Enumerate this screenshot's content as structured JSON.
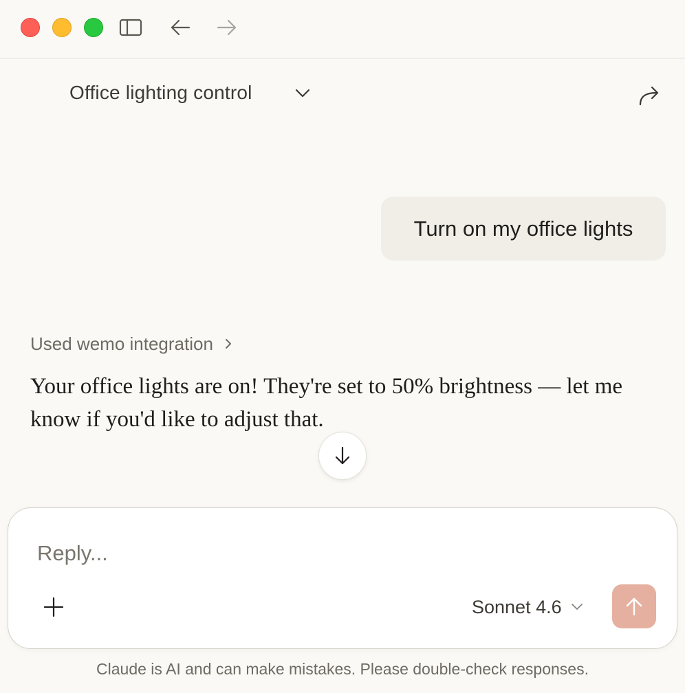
{
  "window": {
    "traffic_lights": {
      "close": "#fe5f57",
      "minimize": "#febc2e",
      "zoom": "#28c840"
    },
    "toolbar_icons": [
      "sidebar-toggle-icon",
      "back-arrow-icon",
      "forward-arrow-icon"
    ]
  },
  "conversation": {
    "title": "Office lighting control",
    "title_menu_icon": "chevron-down-icon",
    "share_icon": "share-arrow-icon"
  },
  "messages": {
    "user": {
      "text": "Turn on my office lights"
    },
    "assistant": {
      "tool_use_label": "Used wemo integration",
      "tool_use_icon": "chevron-right-icon",
      "text": "Your office lights are on! They're set to 50% brightness — let me know if you'd like to adjust that."
    }
  },
  "scroll_button_icon": "arrow-down-icon",
  "composer": {
    "placeholder": "Reply...",
    "add_icon": "plus-icon",
    "model": "Sonnet 4.6",
    "model_icon": "chevron-down-icon",
    "send_icon": "arrow-up-icon",
    "send_color": "#e6b0a0"
  },
  "footer": {
    "disclaimer": "Claude is AI and can make mistakes. Please double-check responses."
  }
}
